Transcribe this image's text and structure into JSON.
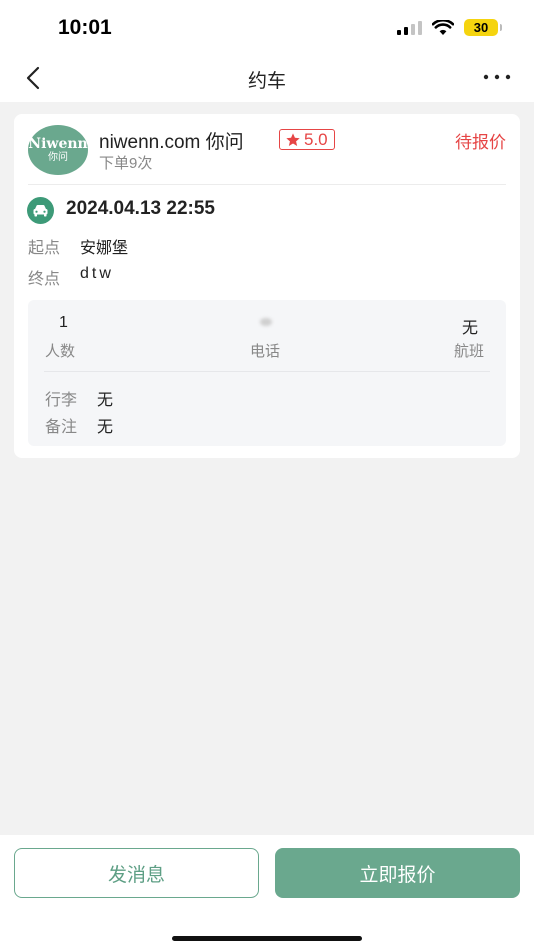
{
  "status_bar": {
    "time": "10:01",
    "battery": "30",
    "icons": [
      "cellular-signal-icon",
      "wifi-icon",
      "battery-icon"
    ]
  },
  "nav": {
    "title": "约车",
    "back_icon": "chevron-left-icon",
    "more_icon": "more-dots-icon"
  },
  "order": {
    "avatar_text_line1": "Niwenn",
    "avatar_text_line2": "你问",
    "user_name": "niwenn.com 你问",
    "rating": "5.0",
    "rating_icon": "star-icon",
    "order_count": "下单9次",
    "status": "待报价",
    "datetime": "2024.04.13 22:55",
    "car_icon": "car-icon",
    "from_label": "起点",
    "from_value": "安娜堡",
    "to_label": "终点",
    "to_value": "dtw"
  },
  "details": {
    "passengers_value": "1",
    "passengers_label": "人数",
    "phone_label": "电话",
    "flight_value": "无",
    "flight_label": "航班",
    "luggage_label": "行李",
    "luggage_value": "无",
    "remark_label": "备注",
    "remark_value": "无"
  },
  "actions": {
    "message_label": "发消息",
    "quote_label": "立即报价"
  },
  "colors": {
    "accent": "#6aa88e",
    "alert": "#e64545",
    "background": "#f2f2f2"
  }
}
